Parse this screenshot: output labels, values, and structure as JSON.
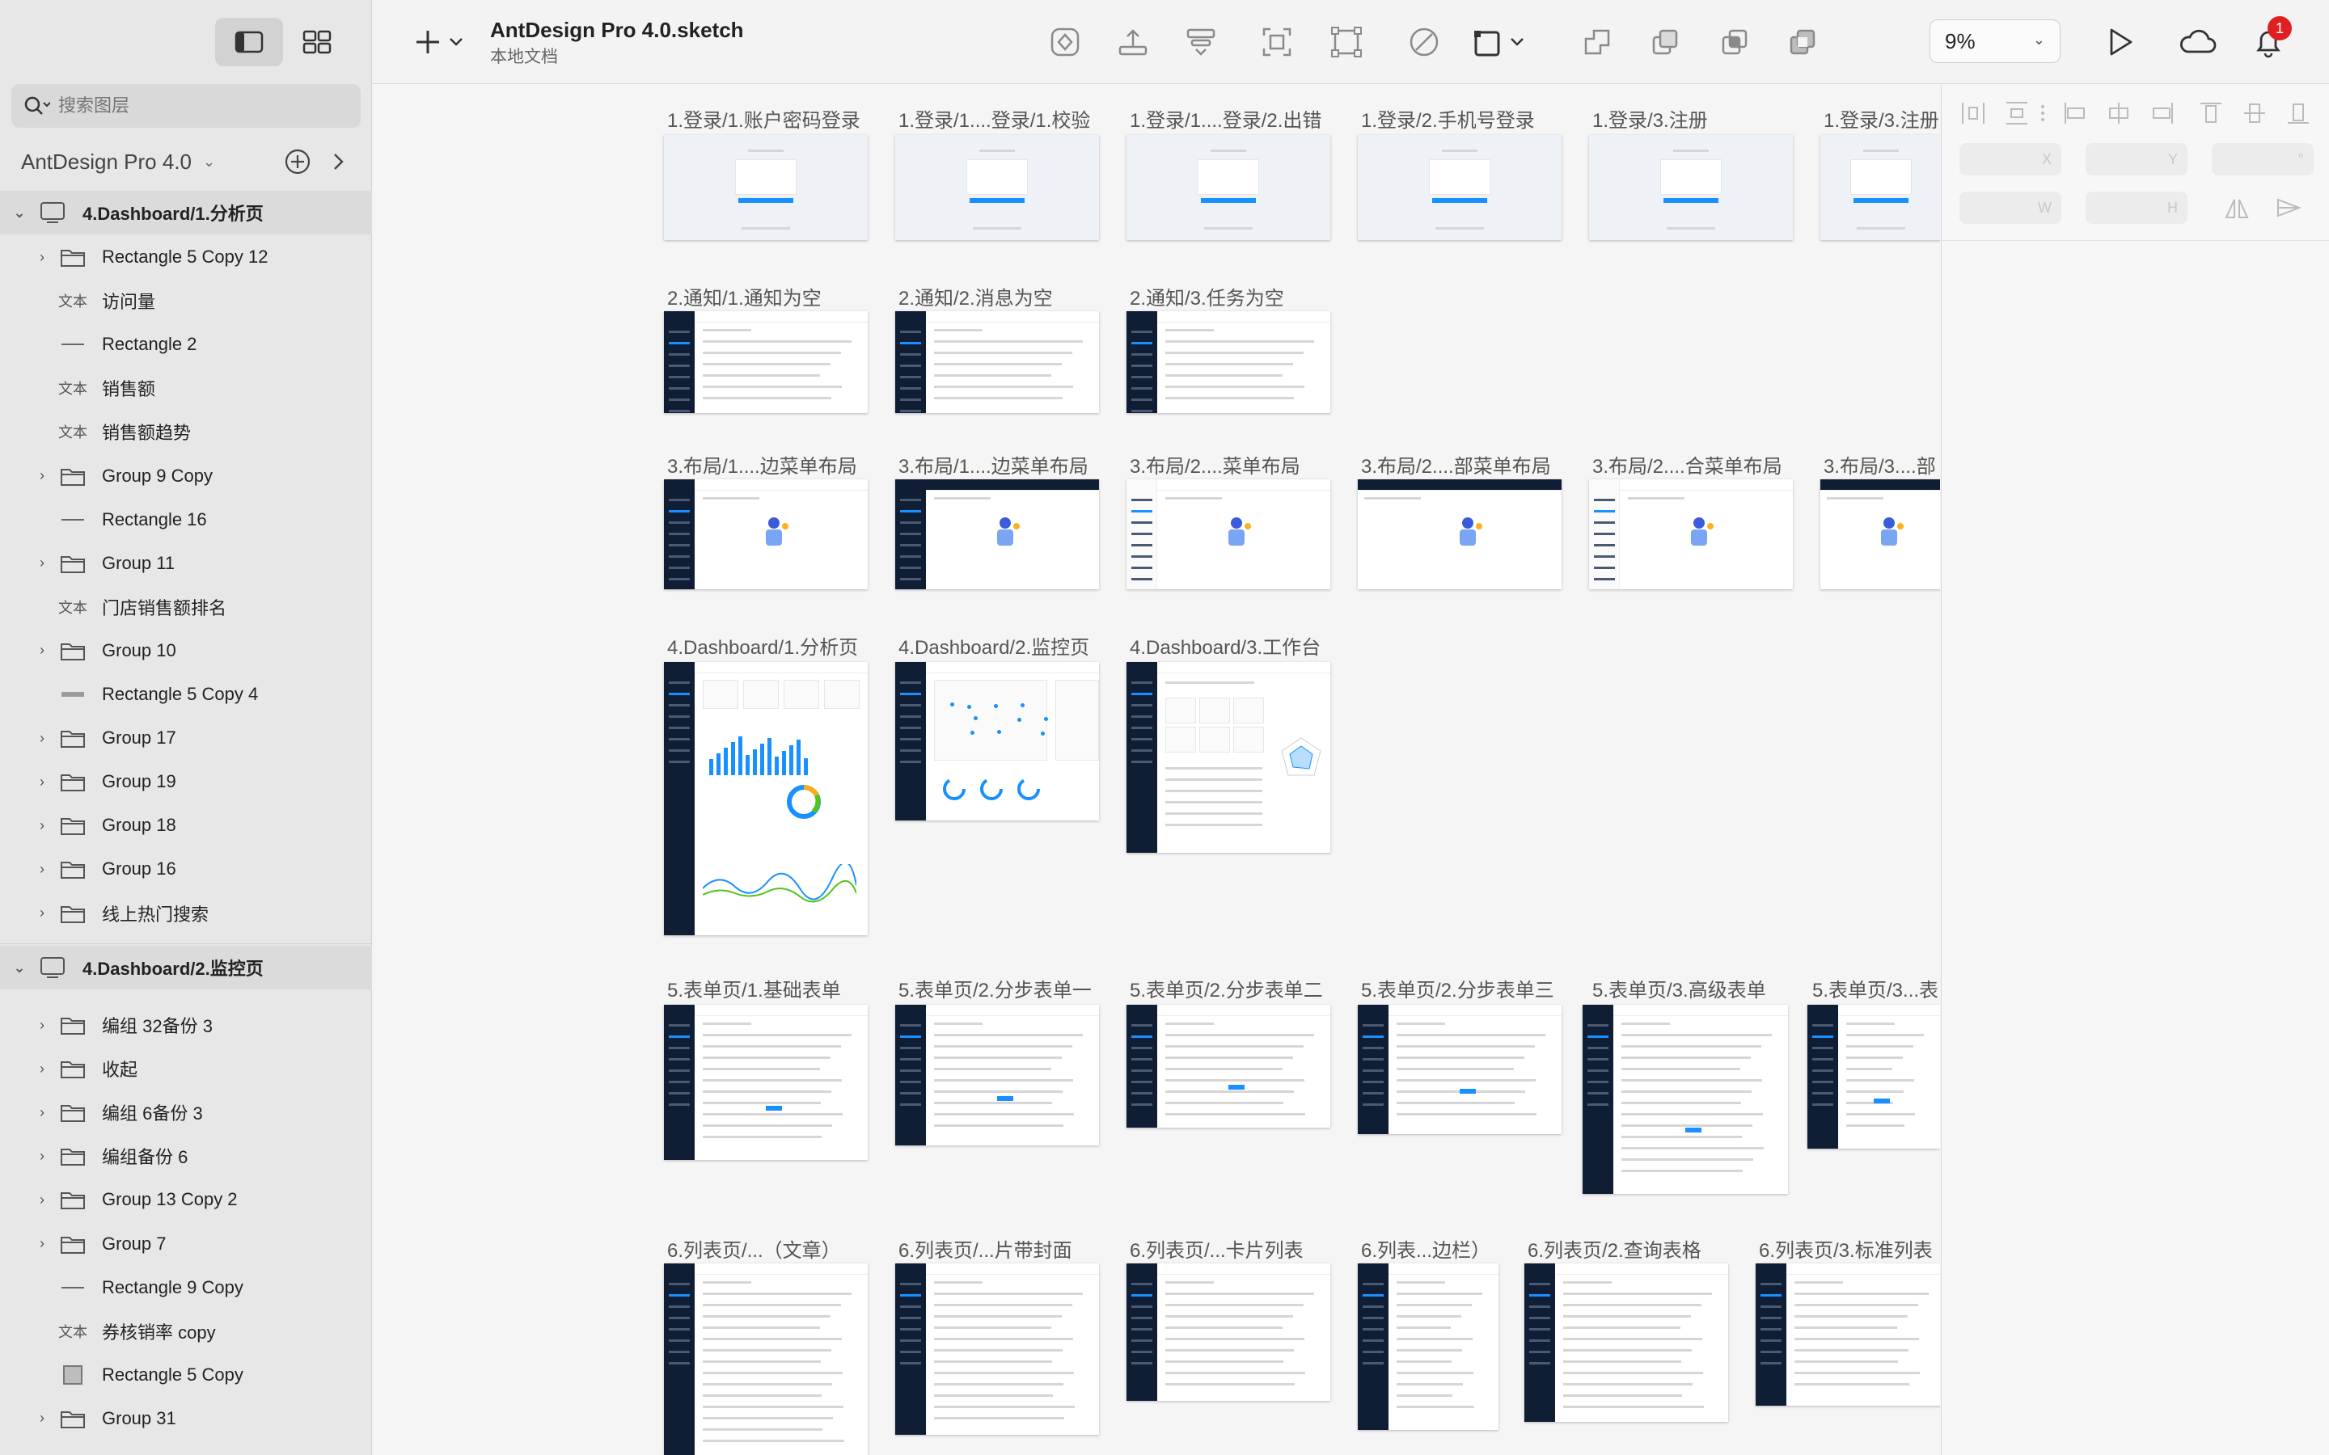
{
  "toolbar": {
    "doc_title": "AntDesign Pro 4.0.sketch",
    "doc_subtitle": "本地文档",
    "zoom": "9%",
    "notification_count": "1",
    "icons": [
      "insert-plus-icon",
      "symbol-icon",
      "upload-icon",
      "layout-icon",
      "frame-icon",
      "transform-icon",
      "edit-icon",
      "resize-icon",
      "union-icon",
      "subtract-icon",
      "intersect-icon",
      "difference-icon",
      "play-icon",
      "cloud-icon",
      "bell-icon"
    ]
  },
  "sidebar": {
    "search_placeholder": "搜索图层",
    "page_name": "AntDesign Pro 4.0",
    "groups": [
      {
        "artboard": "4.Dashboard/1.分析页",
        "layers": [
          {
            "name": "Rectangle 5 Copy 12",
            "type": "folder",
            "expandable": true
          },
          {
            "name": "访问量",
            "type": "text",
            "expandable": false
          },
          {
            "name": "Rectangle 2",
            "type": "line",
            "expandable": false
          },
          {
            "name": "销售额",
            "type": "text",
            "expandable": false
          },
          {
            "name": "销售额趋势",
            "type": "text",
            "expandable": false
          },
          {
            "name": "Group 9 Copy",
            "type": "folder",
            "expandable": true
          },
          {
            "name": "Rectangle 16",
            "type": "line",
            "expandable": false
          },
          {
            "name": "Group 11",
            "type": "folder",
            "expandable": true
          },
          {
            "name": "门店销售额排名",
            "type": "text",
            "expandable": false
          },
          {
            "name": "Group 10",
            "type": "folder",
            "expandable": true
          },
          {
            "name": "Rectangle 5 Copy 4",
            "type": "rect-thin",
            "expandable": false
          },
          {
            "name": "Group 17",
            "type": "folder",
            "expandable": true
          },
          {
            "name": "Group 19",
            "type": "folder",
            "expandable": true
          },
          {
            "name": "Group 18",
            "type": "folder",
            "expandable": true
          },
          {
            "name": "Group 16",
            "type": "folder",
            "expandable": true
          },
          {
            "name": "线上热门搜索",
            "type": "folder",
            "expandable": true
          }
        ]
      },
      {
        "artboard": "4.Dashboard/2.监控页",
        "layers": [
          {
            "name": "编组 32备份 3",
            "type": "folder",
            "expandable": true
          },
          {
            "name": "收起",
            "type": "folder",
            "expandable": true
          },
          {
            "name": "编组 6备份 3",
            "type": "folder",
            "expandable": true
          },
          {
            "name": "编组备份 6",
            "type": "folder",
            "expandable": true
          },
          {
            "name": "Group 13 Copy 2",
            "type": "folder",
            "expandable": true
          },
          {
            "name": "Group 7",
            "type": "folder",
            "expandable": true
          },
          {
            "name": "Rectangle 9 Copy",
            "type": "line",
            "expandable": false
          },
          {
            "name": "券核销率 copy",
            "type": "text",
            "expandable": false
          },
          {
            "name": "Rectangle 5 Copy",
            "type": "rect",
            "expandable": false
          },
          {
            "name": "Group 31",
            "type": "folder",
            "expandable": true
          }
        ]
      }
    ],
    "text_type_label": "文本"
  },
  "canvas": {
    "artboards": [
      {
        "label": "1.登录/1.账户密码登录",
        "kind": "login"
      },
      {
        "label": "1.登录/1....登录/1.校验",
        "kind": "login"
      },
      {
        "label": "1.登录/1....登录/2.出错",
        "kind": "login"
      },
      {
        "label": "1.登录/2.手机号登录",
        "kind": "login"
      },
      {
        "label": "1.登录/3.注册",
        "kind": "login"
      },
      {
        "label": "1.登录/3.注册",
        "kind": "login"
      },
      {
        "label": "2.通知/1.通知为空",
        "kind": "dash"
      },
      {
        "label": "2.通知/2.消息为空",
        "kind": "dash"
      },
      {
        "label": "2.通知/3.任务为空",
        "kind": "dash"
      },
      {
        "label": "3.布局/1....边菜单布局",
        "kind": "layout"
      },
      {
        "label": "3.布局/1....边菜单布局",
        "kind": "layout-dark"
      },
      {
        "label": "3.布局/2....菜单布局",
        "kind": "layout-light"
      },
      {
        "label": "3.布局/2....部菜单布局",
        "kind": "layout-top"
      },
      {
        "label": "3.布局/2....合菜单布局",
        "kind": "layout-light"
      },
      {
        "label": "3.布局/3....部",
        "kind": "layout-top"
      },
      {
        "label": "4.Dashboard/1.分析页",
        "kind": "analysis"
      },
      {
        "label": "4.Dashboard/2.监控页",
        "kind": "monitor"
      },
      {
        "label": "4.Dashboard/3.工作台",
        "kind": "workspace"
      },
      {
        "label": "5.表单页/1.基础表单",
        "kind": "form"
      },
      {
        "label": "5.表单页/2.分步表单一",
        "kind": "form"
      },
      {
        "label": "5.表单页/2.分步表单二",
        "kind": "form"
      },
      {
        "label": "5.表单页/2.分步表单三",
        "kind": "form"
      },
      {
        "label": "5.表单页/3.高级表单",
        "kind": "form"
      },
      {
        "label": "5.表单页/3...表",
        "kind": "form"
      },
      {
        "label": "6.列表页/...（文章）",
        "kind": "list"
      },
      {
        "label": "6.列表页/...片带封面",
        "kind": "list"
      },
      {
        "label": "6.列表页/...卡片列表",
        "kind": "list"
      },
      {
        "label": "6.列表...边栏）",
        "kind": "list"
      },
      {
        "label": "6.列表页/2.查询表格",
        "kind": "list"
      },
      {
        "label": "6.列表页/3.标准列表",
        "kind": "list"
      }
    ]
  },
  "inspector": {
    "x_label": "X",
    "y_label": "Y",
    "rotation_label": "°",
    "w_label": "W",
    "h_label": "H"
  }
}
